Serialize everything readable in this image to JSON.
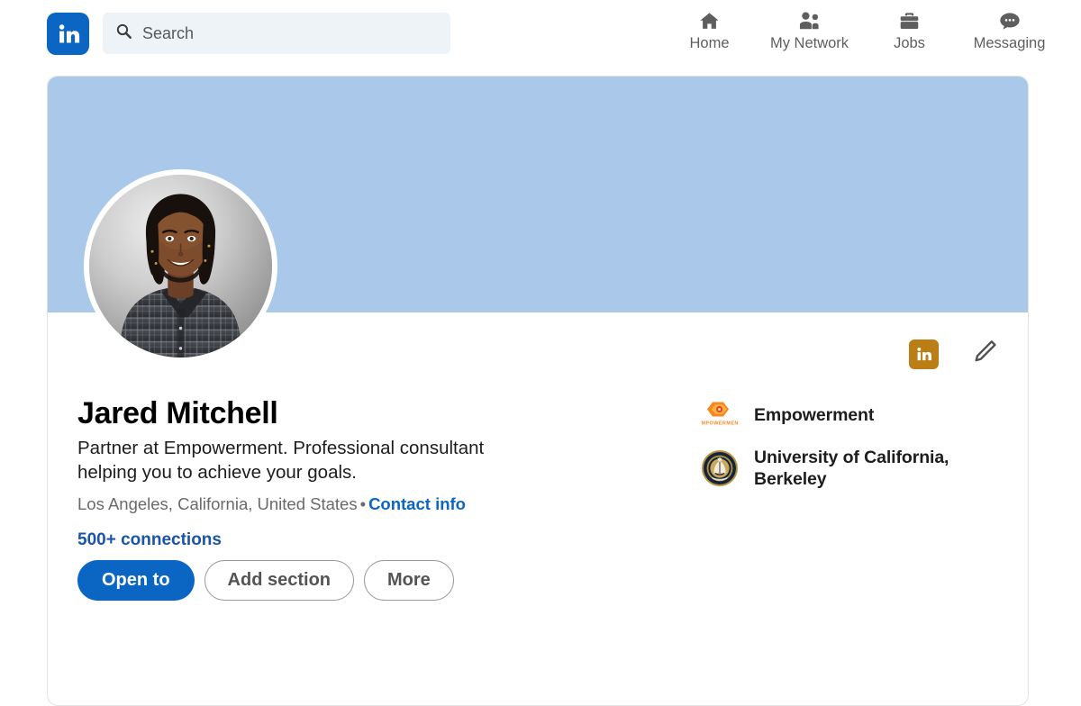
{
  "header": {
    "brand": {
      "icon": "linkedin-logo",
      "color": "#0a66c2"
    },
    "search": {
      "placeholder": "Search",
      "value": "",
      "icon": "search-icon"
    },
    "nav": [
      {
        "label": "Home",
        "icon": "home-icon"
      },
      {
        "label": "My Network",
        "icon": "people-icon"
      },
      {
        "label": "Jobs",
        "icon": "briefcase-icon"
      },
      {
        "label": "Messaging",
        "icon": "message-bubble-icon"
      }
    ]
  },
  "profile": {
    "cover_color": "#aac9ea",
    "avatar": {
      "icon": "profile-photo",
      "alt": "Jared Mitchell"
    },
    "premium_badge": {
      "icon": "linkedin-premium-icon",
      "color": "#bb7e16"
    },
    "edit_button": {
      "icon": "pencil-icon"
    },
    "name": "Jared Mitchell",
    "headline": "Partner at Empowerment. Professional consultant helping you to achieve your goals.",
    "location": "Los Angeles, California, United States",
    "separator": "•",
    "contact_info_label": "Contact info",
    "connections": "500+ connections",
    "accent_color": "#0a66c2",
    "actions": [
      {
        "label": "Open to",
        "style": "primary"
      },
      {
        "label": "Add section",
        "style": "secondary"
      },
      {
        "label": "More",
        "style": "secondary"
      }
    ],
    "affiliations": [
      {
        "name": "Empowerment",
        "logo": "empowerment-logo",
        "logo_text": "EMPOWERMENT"
      },
      {
        "name": "University of California, Berkeley",
        "logo": "uc-berkeley-seal"
      }
    ]
  }
}
